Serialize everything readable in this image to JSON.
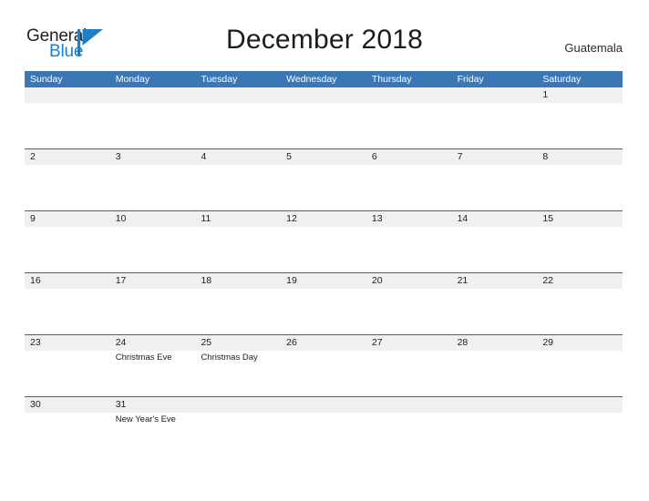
{
  "brand": {
    "word_one": "General",
    "word_two": "Blue",
    "mark": "sail-triangle-logo",
    "color_dark": "#231f20",
    "color_blue": "#1d7fc4"
  },
  "header": {
    "title": "December 2018",
    "locale": "Guatemala"
  },
  "theme": {
    "header_blue": "#3a77b4",
    "rule_blue": "#2e6da4",
    "band_gray": "#f0f0f0",
    "text_dark": "#1c1c1c"
  },
  "calendar": {
    "weekdays": [
      "Sunday",
      "Monday",
      "Tuesday",
      "Wednesday",
      "Thursday",
      "Friday",
      "Saturday"
    ],
    "weeks": [
      [
        {
          "day": "",
          "event": ""
        },
        {
          "day": "",
          "event": ""
        },
        {
          "day": "",
          "event": ""
        },
        {
          "day": "",
          "event": ""
        },
        {
          "day": "",
          "event": ""
        },
        {
          "day": "",
          "event": ""
        },
        {
          "day": "1",
          "event": ""
        }
      ],
      [
        {
          "day": "2",
          "event": ""
        },
        {
          "day": "3",
          "event": ""
        },
        {
          "day": "4",
          "event": ""
        },
        {
          "day": "5",
          "event": ""
        },
        {
          "day": "6",
          "event": ""
        },
        {
          "day": "7",
          "event": ""
        },
        {
          "day": "8",
          "event": ""
        }
      ],
      [
        {
          "day": "9",
          "event": ""
        },
        {
          "day": "10",
          "event": ""
        },
        {
          "day": "11",
          "event": ""
        },
        {
          "day": "12",
          "event": ""
        },
        {
          "day": "13",
          "event": ""
        },
        {
          "day": "14",
          "event": ""
        },
        {
          "day": "15",
          "event": ""
        }
      ],
      [
        {
          "day": "16",
          "event": ""
        },
        {
          "day": "17",
          "event": ""
        },
        {
          "day": "18",
          "event": ""
        },
        {
          "day": "19",
          "event": ""
        },
        {
          "day": "20",
          "event": ""
        },
        {
          "day": "21",
          "event": ""
        },
        {
          "day": "22",
          "event": ""
        }
      ],
      [
        {
          "day": "23",
          "event": ""
        },
        {
          "day": "24",
          "event": "Christmas Eve"
        },
        {
          "day": "25",
          "event": "Christmas Day"
        },
        {
          "day": "26",
          "event": ""
        },
        {
          "day": "27",
          "event": ""
        },
        {
          "day": "28",
          "event": ""
        },
        {
          "day": "29",
          "event": ""
        }
      ],
      [
        {
          "day": "30",
          "event": ""
        },
        {
          "day": "31",
          "event": "New Year's Eve"
        },
        {
          "day": "",
          "event": ""
        },
        {
          "day": "",
          "event": ""
        },
        {
          "day": "",
          "event": ""
        },
        {
          "day": "",
          "event": ""
        },
        {
          "day": "",
          "event": ""
        }
      ]
    ]
  }
}
